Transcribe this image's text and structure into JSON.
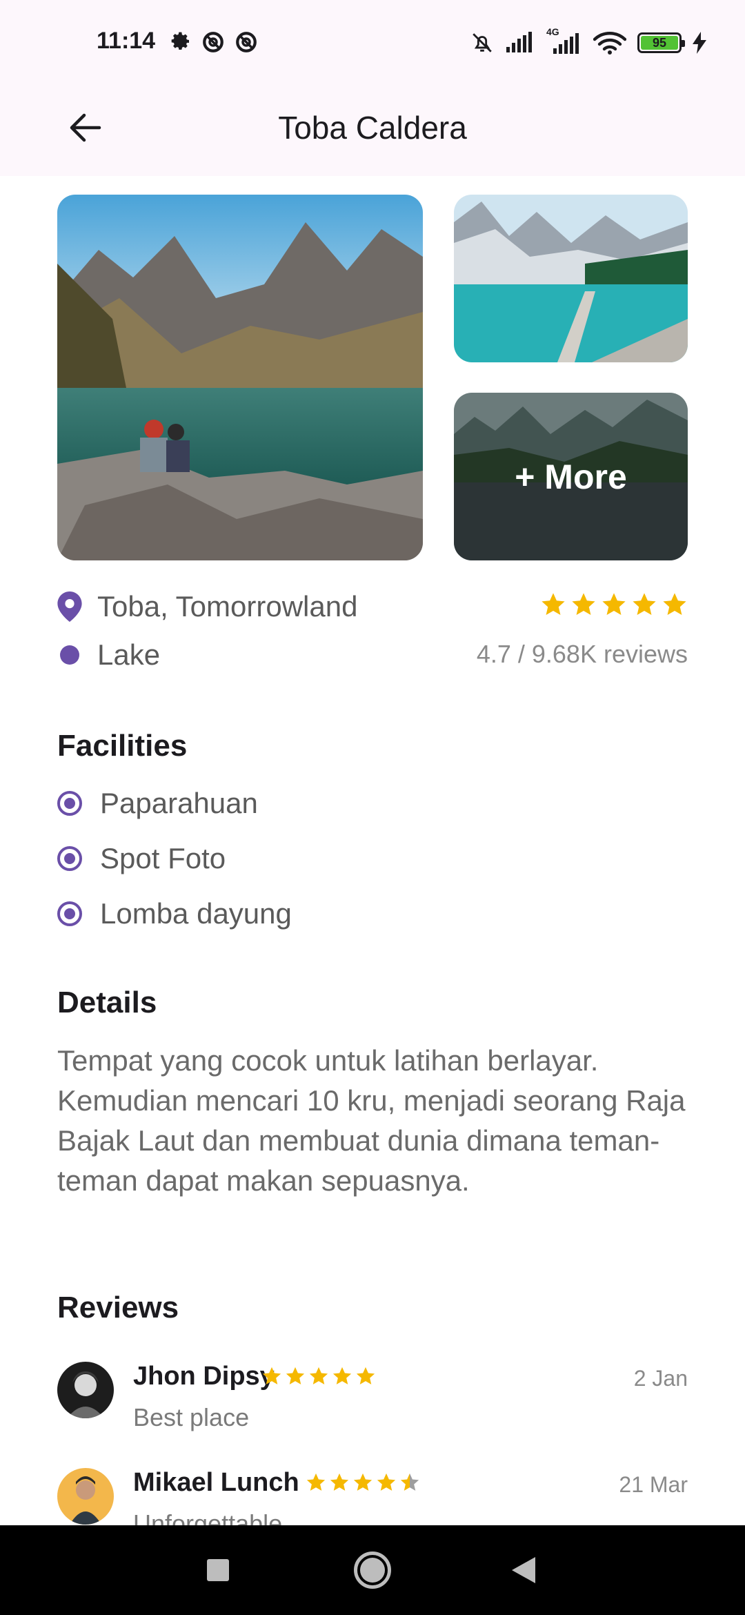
{
  "status_bar": {
    "time": "11:14",
    "battery": "95",
    "network_type": "4G"
  },
  "app_bar": {
    "title": "Toba Caldera"
  },
  "gallery": {
    "more_label": "+ More"
  },
  "info": {
    "location": "Toba, Tomorrowland",
    "category": "Lake",
    "rating_stars": 5,
    "rating_text": "4.7 / 9.68K reviews"
  },
  "facilities": {
    "title": "Facilities",
    "items": [
      "Paparahuan",
      "Spot Foto",
      "Lomba dayung"
    ]
  },
  "details": {
    "title": "Details",
    "text": "Tempat yang cocok untuk latihan berlayar. Kemudian mencari 10 kru, menjadi seorang Raja Bajak Laut dan membuat dunia dimana teman-teman dapat makan sepuasnya."
  },
  "reviews": {
    "title": "Reviews",
    "items": [
      {
        "name": "Jhon Dipsy",
        "stars": 5,
        "date": "2 Jan",
        "text": "Best place"
      },
      {
        "name": "Mikael Lunch",
        "stars": 4.5,
        "date": "21 Mar",
        "text": "Unforgettable"
      }
    ]
  },
  "colors": {
    "accent": "#6a4fa8",
    "star": "#f5b800",
    "app_bar_bg": "#fdf7fc"
  }
}
